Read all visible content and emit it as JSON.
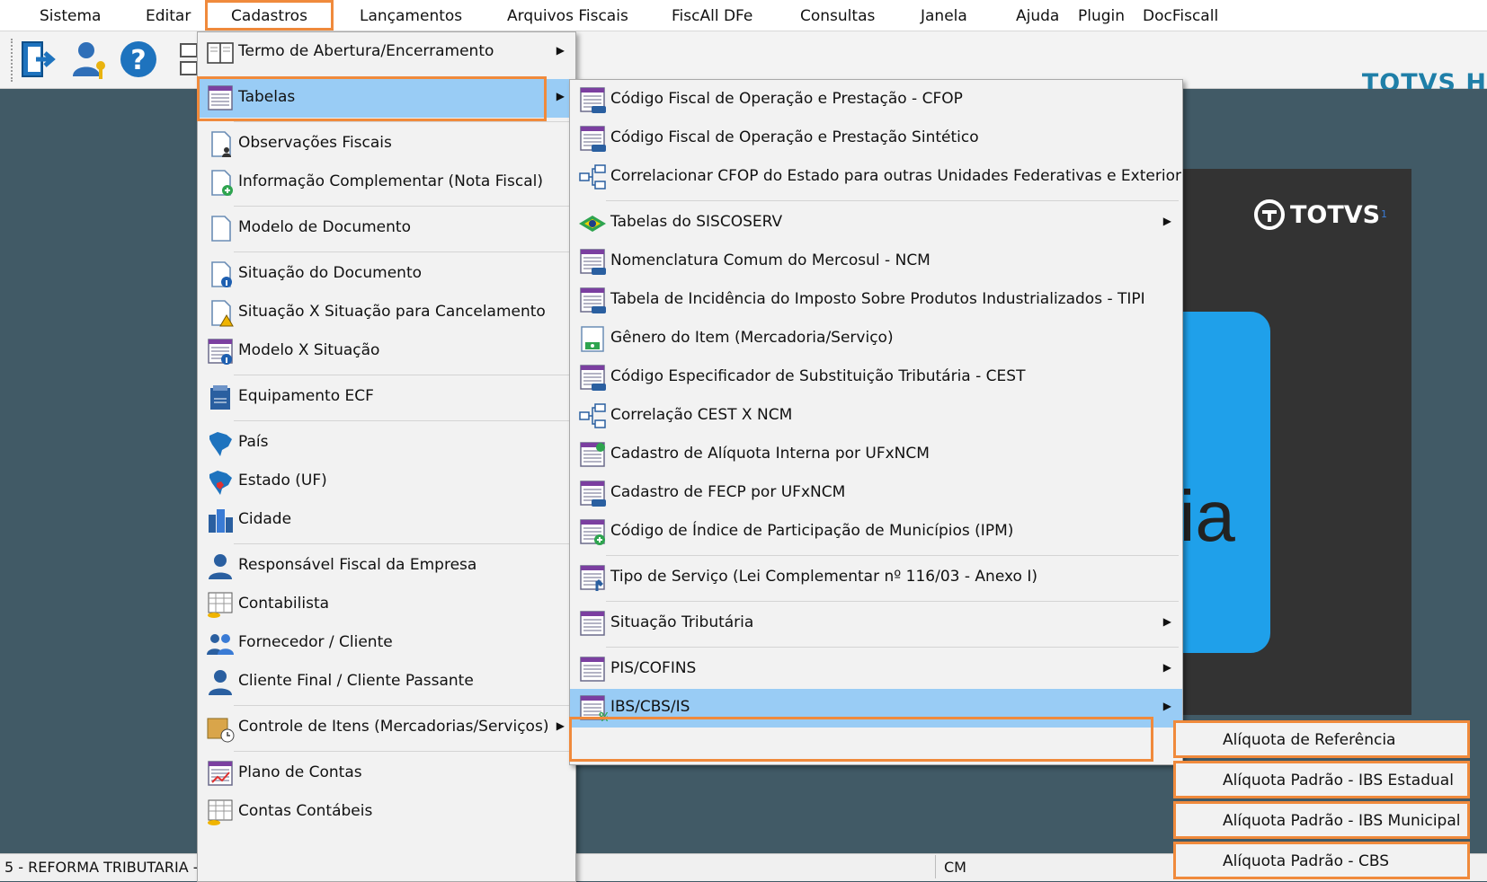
{
  "menubar": {
    "items": [
      "Sistema",
      "Editar",
      "Cadastros",
      "Lançamentos",
      "Arquivos Fiscais",
      "FiscAll DFe",
      "Consultas",
      "Janela",
      "Ajuda",
      "Plugin",
      "DocFiscall"
    ],
    "active": "Cadastros"
  },
  "toolbar": {
    "brand": "TOTVS H",
    "buttons": [
      "exit-icon",
      "user-key-icon",
      "help-icon"
    ]
  },
  "splash": {
    "logo": "TOTVS",
    "badge": "1",
    "text": "ria"
  },
  "cadastros_menu": {
    "items": [
      {
        "label": "Termo de Abertura/Encerramento",
        "icon": "book-icon",
        "submenu": true
      },
      {
        "label": "Tabelas",
        "icon": "table-icon",
        "submenu": true,
        "highlighted": true
      },
      {
        "label": "Observações Fiscais",
        "icon": "document-people-icon"
      },
      {
        "label": "Informação Complementar (Nota Fiscal)",
        "icon": "document-add-icon"
      },
      {
        "label": "Modelo de Documento",
        "icon": "blank-document-icon"
      },
      {
        "label": "Situação do Documento",
        "icon": "document-info-icon"
      },
      {
        "label": "Situação X Situação para Cancelamento",
        "icon": "document-warning-icon"
      },
      {
        "label": "Modelo X Situação",
        "icon": "list-info-icon"
      },
      {
        "label": "Equipamento ECF",
        "icon": "ecf-printer-icon"
      },
      {
        "label": "País",
        "icon": "country-map-icon"
      },
      {
        "label": "Estado (UF)",
        "icon": "state-map-icon"
      },
      {
        "label": "Cidade",
        "icon": "city-buildings-icon"
      },
      {
        "label": "Responsável Fiscal da Empresa",
        "icon": "person-icon"
      },
      {
        "label": "Contabilista",
        "icon": "calendar-coins-icon"
      },
      {
        "label": "Fornecedor / Cliente",
        "icon": "people-icon"
      },
      {
        "label": "Cliente Final / Cliente Passante",
        "icon": "person-icon"
      },
      {
        "label": "Controle de Itens (Mercadorias/Serviços)",
        "icon": "box-clock-icon",
        "submenu": true
      },
      {
        "label": "Plano de Contas",
        "icon": "chart-of-accounts-icon"
      },
      {
        "label": "Contas Contábeis",
        "icon": "accounts-coins-icon"
      }
    ]
  },
  "tabelas_menu": {
    "items": [
      {
        "label": "Código Fiscal de Operação e Prestação - CFOP",
        "icon": "cfop-table-icon"
      },
      {
        "label": "Código Fiscal de Operação e Prestação Sintético",
        "icon": "cfop-table-icon"
      },
      {
        "label": "Correlacionar CFOP do Estado para outras Unidades Federativas e Exterior",
        "icon": "correlation-icon"
      },
      {
        "label": "Tabelas do SISCOSERV",
        "icon": "brazil-flag-icon",
        "submenu": true
      },
      {
        "label": "Nomenclatura Comum do Mercosul  - NCM",
        "icon": "ncm-table-icon"
      },
      {
        "label": "Tabela de Incidência do Imposto Sobre Produtos Industrializados - TIPI",
        "icon": "tipi-table-icon"
      },
      {
        "label": "Gênero do Item (Mercadoria/Serviço)",
        "icon": "money-document-icon"
      },
      {
        "label": "Código Especificador de Substituição Tributária - CEST",
        "icon": "cest-table-icon"
      },
      {
        "label": "Correlação CEST X NCM",
        "icon": "correlation-icon"
      },
      {
        "label": "Cadastro de Alíquota Interna por UFxNCM",
        "icon": "rate-table-icon"
      },
      {
        "label": "Cadastro de FECP por UFxNCM",
        "icon": "fecp-table-icon"
      },
      {
        "label": "Código de Índice de Participação de Municípios (IPM)",
        "icon": "table-add-icon"
      },
      {
        "label": "Tipo de Serviço (Lei Complementar nº 116/03 - Anexo I)",
        "icon": "service-table-icon"
      },
      {
        "label": "Situação Tributária",
        "icon": "table-icon",
        "submenu": true
      },
      {
        "label": "PIS/COFINS",
        "icon": "table-icon",
        "submenu": true
      },
      {
        "label": "IBS/CBS/IS",
        "icon": "percent-table-icon",
        "submenu": true,
        "highlighted": true
      }
    ]
  },
  "ibs_menu": {
    "items": [
      "Alíquota de Referência",
      "Alíquota Padrão - IBS Estadual",
      "Alíquota Padrão - IBS Municipal",
      "Alíquota Padrão - CBS"
    ]
  },
  "statusbar": {
    "left": "5 - REFORMA TRIBUTARIA -",
    "mid": "CM"
  },
  "colors": {
    "highlight": "#99ccf5",
    "outline": "#f08a3c",
    "workspace": "#415a66",
    "brand": "#1f7fa8"
  }
}
